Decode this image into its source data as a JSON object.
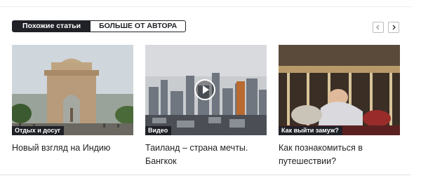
{
  "tabs": {
    "related_label": "Похожие статьи",
    "author_label": "БОЛЬШЕ ОТ АВТОРА"
  },
  "nav_icons": {
    "prev": "chevron-left-icon",
    "next": "chevron-right-icon"
  },
  "colors": {
    "dark": "#1f2127",
    "text": "#222222",
    "border": "#bdbdbd"
  },
  "articles": [
    {
      "category": "Отдых и досуг",
      "title": "Новый взгляд на Индию",
      "image": "india-gate-photo"
    },
    {
      "category": "Видео",
      "title": "Таиланд – страна мечты. Бангкок",
      "image": "bangkok-skyline-photo",
      "icon": "play-icon"
    },
    {
      "category": "Как выйти замуж?",
      "title": "Как познакомиться в путешествии?",
      "image": "carousel-photo"
    }
  ]
}
